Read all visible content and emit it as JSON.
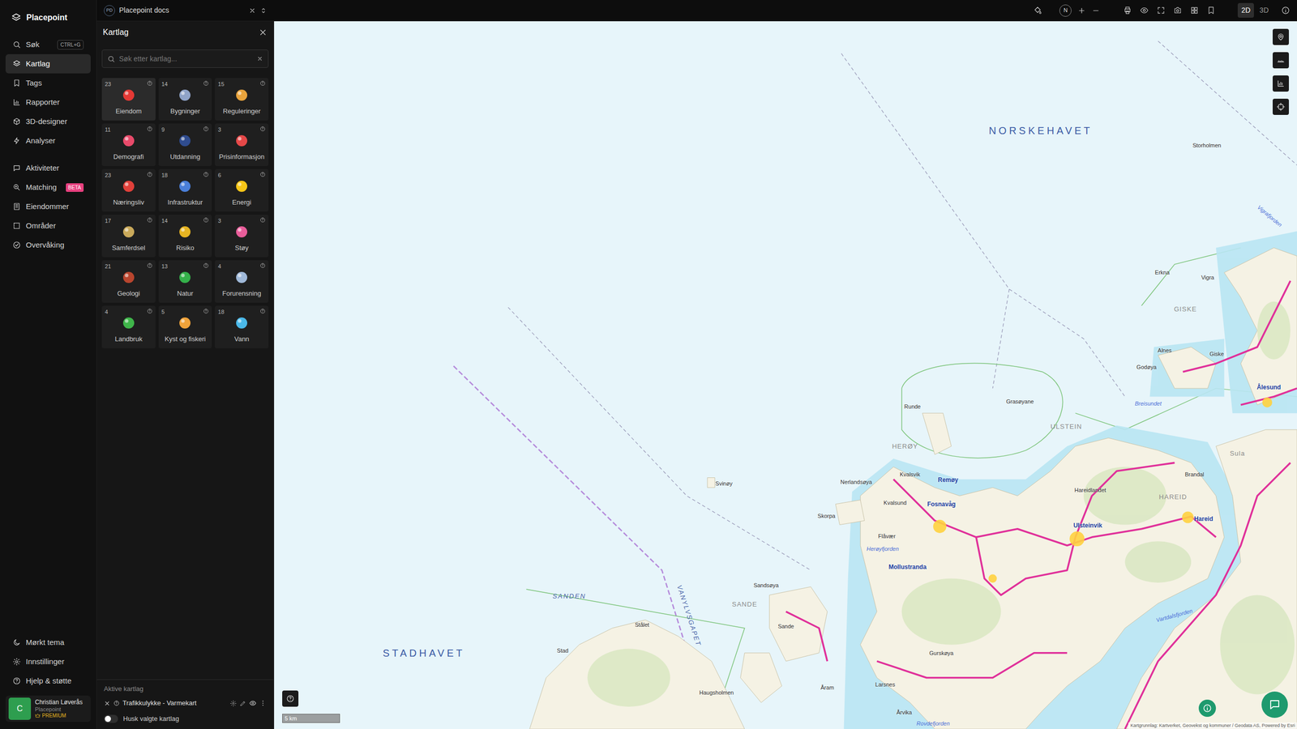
{
  "app": {
    "name": "Placepoint"
  },
  "nav": {
    "primary": [
      {
        "label": "Søk",
        "shortcut": "CTRL+G",
        "selected": false
      },
      {
        "label": "Kartlag",
        "selected": true
      },
      {
        "label": "Tags",
        "selected": false
      },
      {
        "label": "Rapporter",
        "selected": false
      },
      {
        "label": "3D-designer",
        "selected": false
      },
      {
        "label": "Analyser",
        "selected": false
      }
    ],
    "secondary": [
      {
        "label": "Aktiviteter",
        "selected": false
      },
      {
        "label": "Matching",
        "badge": "BETA",
        "selected": false
      },
      {
        "label": "Eiendommer",
        "selected": false
      },
      {
        "label": "Områder",
        "selected": false
      },
      {
        "label": "Overvåking",
        "selected": false
      }
    ],
    "footer": [
      {
        "label": "Mørkt tema"
      },
      {
        "label": "Innstillinger"
      },
      {
        "label": "Hjelp & støtte"
      }
    ],
    "user": {
      "initial": "C",
      "name": "Christian Løverås",
      "org": "Placepoint",
      "plan": "PREMIUM"
    }
  },
  "tab": {
    "badge": "PD",
    "title": "Placepoint docs"
  },
  "toolbar": {
    "compass": "N",
    "modes": [
      {
        "label": "2D",
        "selected": true
      },
      {
        "label": "3D",
        "selected": false
      }
    ]
  },
  "layers_panel": {
    "title": "Kartlag",
    "search": {
      "placeholder": "Søk etter kartlag..."
    },
    "categories": [
      {
        "count": "23",
        "label": "Eiendom",
        "selected": true
      },
      {
        "count": "14",
        "label": "Bygninger",
        "selected": false
      },
      {
        "count": "15",
        "label": "Reguleringer",
        "selected": false
      },
      {
        "count": "11",
        "label": "Demografi",
        "selected": false
      },
      {
        "count": "9",
        "label": "Utdanning",
        "selected": false
      },
      {
        "count": "3",
        "label": "Prisinformasjon",
        "selected": false
      },
      {
        "count": "23",
        "label": "Næringsliv",
        "selected": false
      },
      {
        "count": "18",
        "label": "Infrastruktur",
        "selected": false
      },
      {
        "count": "6",
        "label": "Energi",
        "selected": false
      },
      {
        "count": "17",
        "label": "Samferdsel",
        "selected": false
      },
      {
        "count": "14",
        "label": "Risiko",
        "selected": false
      },
      {
        "count": "3",
        "label": "Støy",
        "selected": false
      },
      {
        "count": "21",
        "label": "Geologi",
        "selected": false
      },
      {
        "count": "13",
        "label": "Natur",
        "selected": false
      },
      {
        "count": "4",
        "label": "Forurensning",
        "selected": false
      },
      {
        "count": "4",
        "label": "Landbruk",
        "selected": false
      },
      {
        "count": "5",
        "label": "Kyst og fiskeri",
        "selected": false
      },
      {
        "count": "18",
        "label": "Vann",
        "selected": false
      }
    ],
    "active": {
      "title": "Aktive kartlag",
      "layers": [
        {
          "name": "Trafikkulykke - Varmekart",
          "visible": true
        }
      ]
    },
    "remember": {
      "label": "Husk valgte kartlag",
      "on": false
    }
  },
  "map": {
    "labels": [
      {
        "text": "NORSKEHAVET",
        "kind": "sea"
      },
      {
        "text": "STADHAVET",
        "kind": "sea"
      },
      {
        "text": "SANDEN",
        "kind": "seasmall"
      },
      {
        "text": "VANYLVSGAPET",
        "kind": "seasmall"
      },
      {
        "text": "Storholmen",
        "kind": "place"
      },
      {
        "text": "Erkna",
        "kind": "place"
      },
      {
        "text": "Vigra",
        "kind": "place"
      },
      {
        "text": "GISKE",
        "kind": "region"
      },
      {
        "text": "Alnes",
        "kind": "place"
      },
      {
        "text": "Giske",
        "kind": "place"
      },
      {
        "text": "Godøya",
        "kind": "place"
      },
      {
        "text": "Ålesund",
        "kind": "town"
      },
      {
        "text": "Breisundet",
        "kind": "water"
      },
      {
        "text": "Runde",
        "kind": "place"
      },
      {
        "text": "Grasøyane",
        "kind": "place"
      },
      {
        "text": "HERØY",
        "kind": "region"
      },
      {
        "text": "ULSTEIN",
        "kind": "region"
      },
      {
        "text": "Nerlandsøya",
        "kind": "place"
      },
      {
        "text": "Kvalsvik",
        "kind": "place"
      },
      {
        "text": "Remøy",
        "kind": "town"
      },
      {
        "text": "Svinøy",
        "kind": "place"
      },
      {
        "text": "Kvalsund",
        "kind": "place"
      },
      {
        "text": "Fosnavåg",
        "kind": "town"
      },
      {
        "text": "Skorpa",
        "kind": "place"
      },
      {
        "text": "Hareidlandet",
        "kind": "place"
      },
      {
        "text": "Brandal",
        "kind": "place"
      },
      {
        "text": "HAREID",
        "kind": "region"
      },
      {
        "text": "Ulsteinvik",
        "kind": "town"
      },
      {
        "text": "Hareid",
        "kind": "town"
      },
      {
        "text": "Sula",
        "kind": "region"
      },
      {
        "text": "Flåvær",
        "kind": "place"
      },
      {
        "text": "Herøyfjorden",
        "kind": "water"
      },
      {
        "text": "Mollustranda",
        "kind": "town"
      },
      {
        "text": "Sandsøya",
        "kind": "place"
      },
      {
        "text": "SANDE",
        "kind": "region"
      },
      {
        "text": "Sande",
        "kind": "place"
      },
      {
        "text": "Stålet",
        "kind": "place"
      },
      {
        "text": "Stad",
        "kind": "place"
      },
      {
        "text": "Gurskøya",
        "kind": "place"
      },
      {
        "text": "Vartdalsfjorden",
        "kind": "water"
      },
      {
        "text": "Haugsholmen",
        "kind": "place"
      },
      {
        "text": "Åram",
        "kind": "place"
      },
      {
        "text": "Larsnes",
        "kind": "place"
      },
      {
        "text": "Årvika",
        "kind": "place"
      },
      {
        "text": "Rovdefjorden",
        "kind": "water"
      },
      {
        "text": "Vigrafjorden",
        "kind": "water"
      }
    ],
    "scale": "5 km",
    "attribution": "Kartgrunnlag: Kartverket, Geovekst og kommuner / Geodata AS, Powered by Esri"
  }
}
